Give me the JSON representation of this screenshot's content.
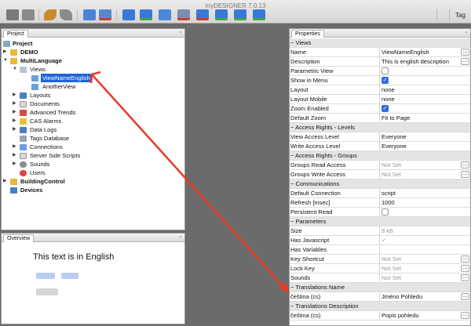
{
  "app": {
    "title": "myDESIGNER 7.0.13",
    "tag_label": "Tag"
  },
  "colors": {
    "accent": "#1f64d8",
    "arrow": "#e63b25",
    "toolbar_blue": "#3a78d8",
    "toolbar_grey": "#6d6d6d"
  },
  "toolbar": {
    "icons": [
      "save-icon",
      "save-all-icon",
      "undo-icon",
      "redo-icon",
      "import-icon",
      "delete-icon",
      "new-view-icon",
      "add-view-icon",
      "duplicate-icon",
      "close-view-icon",
      "view-delete-icon",
      "view-up-icon",
      "view-down-icon",
      "view-forward-icon"
    ]
  },
  "project_panel": {
    "tab": "Project",
    "tree": {
      "project": "Project",
      "demo": "DEMO",
      "multilanguage": "MultiLanguage",
      "views": "Views",
      "view1": "ViewNameEnglish",
      "view2": "AnotherView",
      "layouts": "Layouts",
      "documents": "Documents",
      "trends": "Advanced Trends",
      "alarms": "CAS Alarms",
      "datalogs": "Data Logs",
      "tagsdb": "Tags Database",
      "connections": "Connections",
      "scripts": "Server Side Scripts",
      "sounds": "Sounds",
      "users": "Users",
      "building": "BuildingControl",
      "devices": "Devices"
    }
  },
  "overview_panel": {
    "tab": "Overview",
    "heading": "This text is in English"
  },
  "properties_panel": {
    "tab": "Properties",
    "groups": {
      "views": "Views",
      "access": "Access Rights - Levels",
      "access_groups": "Access Rights - Groups",
      "comm": "Communications",
      "params": "Parameters",
      "trans_name": "Translations Name",
      "trans_desc": "Translations Description"
    },
    "rows": {
      "name_k": "Name",
      "name_v": "ViewNameEnglish",
      "desc_k": "Description",
      "desc_v": "This is english description",
      "param_k": "Parametric View",
      "show_k": "Show in Menu",
      "layout_k": "Layout",
      "layout_v": "none",
      "layoutm_k": "Layout Mobile",
      "layoutm_v": "none",
      "zoom_k": "Zoom Enabled",
      "defzoom_k": "Default Zoom",
      "defzoom_v": "Fit to Page",
      "val_k": "View Access Level",
      "val_v": "Everyone",
      "wal_k": "Write Access Level",
      "wal_v": "Everyone",
      "gra_k": "Groups Read Access",
      "gra_v": "Not Set",
      "gwa_k": "Groups Write Access",
      "gwa_v": "Not Set",
      "conn_k": "Default Connection",
      "conn_v": "script",
      "refresh_k": "Refresh [msec]",
      "refresh_v": "1000",
      "persist_k": "Persistent Read",
      "size_k": "Size",
      "size_v": "8 kB",
      "js_k": "Has Javascript",
      "vars_k": "Has Variables",
      "key_k": "Key Shortcut",
      "key_v": "Not Set",
      "lock_k": "Lock Key",
      "lock_v": "Not Set",
      "sounds_k": "Sounds",
      "sounds_v": "Not Set",
      "tn_k": "čeština (cs)",
      "tn_v": "Jméno Pohledu",
      "td_k": "čeština (cs)",
      "td_v": "Popis pohledu"
    }
  }
}
